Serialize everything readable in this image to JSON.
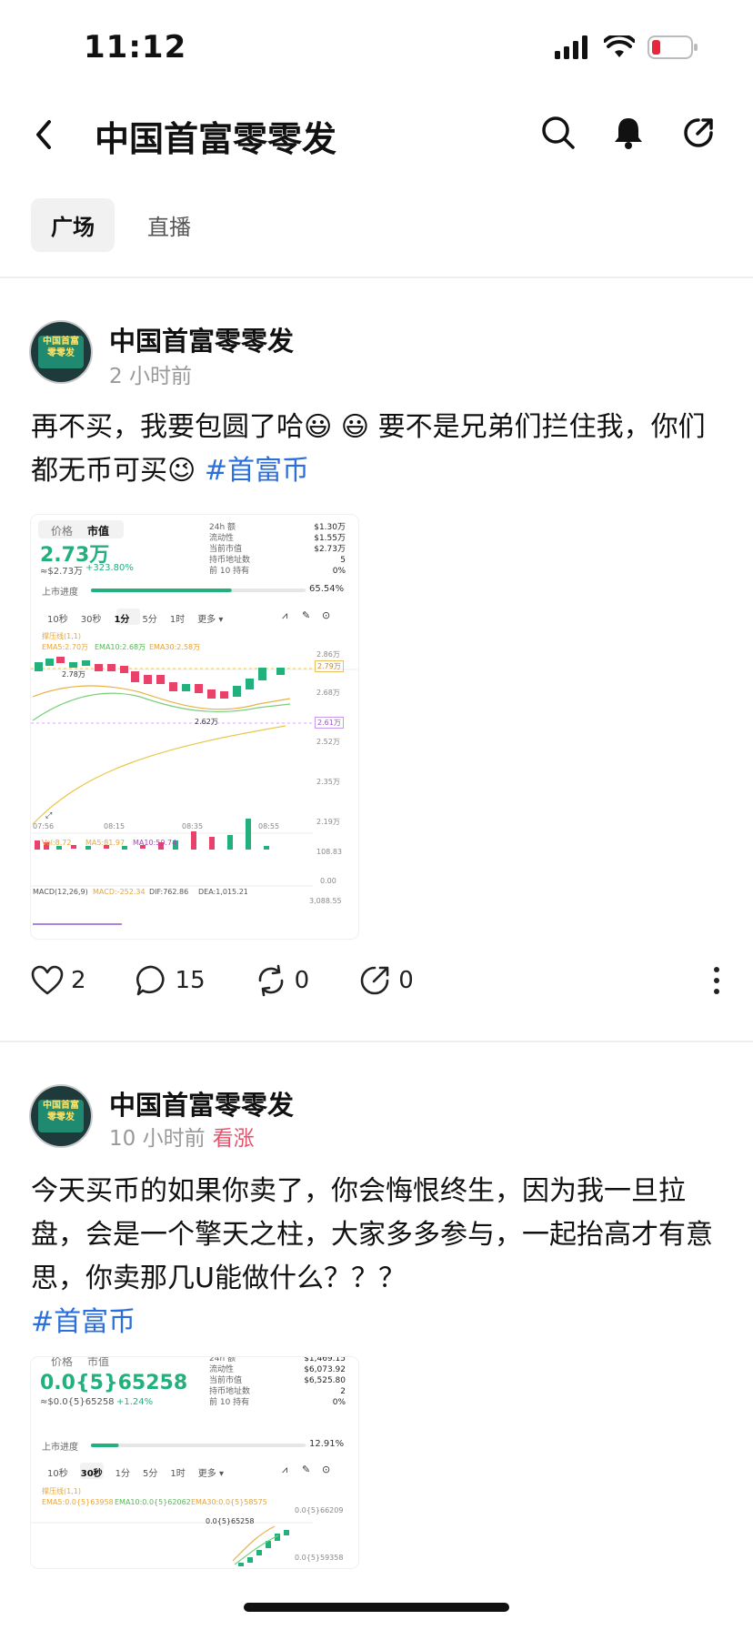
{
  "status": {
    "time": "11:12"
  },
  "header": {
    "title": "中国首富零零发"
  },
  "tabs": [
    {
      "label": "广场"
    },
    {
      "label": "直播"
    }
  ],
  "posts": [
    {
      "author": "中国首富零零发",
      "avatar_text": "中国首富 零零发",
      "time": "2 小时前",
      "tag": "",
      "text": "再不买，我要包圆了哈😃 😃 要不是兄弟们拦住我，你们都无币可买😉 ",
      "hashtag": "#首富币",
      "likes": "2",
      "comments": "15",
      "reposts": "0",
      "shares": "0",
      "chart": {
        "tab_price": "价格",
        "tab_mcap": "市值",
        "value": "2.73万",
        "sub_value": "≈$2.73万",
        "change": "+323.80%",
        "stats": [
          {
            "label": "24h 额",
            "value": "$1.30万"
          },
          {
            "label": "流动性",
            "value": "$1.55万"
          },
          {
            "label": "当前市值",
            "value": "$2.73万"
          },
          {
            "label": "持币地址数",
            "value": "5"
          },
          {
            "label": "前 10 持有",
            "value": "0%"
          }
        ],
        "progress_label": "上市进度",
        "progress_text": "65.54%",
        "progress": 0.6554,
        "intervals": [
          "10秒",
          "30秒",
          "1分",
          "5分",
          "1时",
          "更多 ▾"
        ],
        "active_interval": "1分",
        "indicator": "撑压线(1,1)",
        "ema5": "EMA5:2.70万",
        "ema10": "EMA10:2.68万",
        "ema30": "EMA30:2.58万",
        "y_labels": [
          "2.86万",
          "2.79万",
          "2.68万",
          "2.61万",
          "2.52万",
          "2.35万",
          "2.19万"
        ],
        "high_label": "2.78万",
        "low_label": "2.62万",
        "x_labels": [
          "07:56",
          "08:15",
          "08:35",
          "08:55"
        ],
        "vol": "Vol:8.72",
        "ma5": "MA5:81.97",
        "ma10": "MA10:50.74",
        "vol_max": "108.83",
        "vol_min": "0.00",
        "macd": "MACD(12,26,9)",
        "macd_val": "MACD:-252.34",
        "dif": "DIF:762.86",
        "dea": "DEA:1,015.21",
        "macd_max": "3,088.55"
      }
    },
    {
      "author": "中国首富零零发",
      "avatar_text": "中国首富 零零发",
      "time": "10 小时前",
      "tag": "看涨",
      "text": "今天买币的如果你卖了，你会悔恨终生，因为我一旦拉盘，会是一个擎天之柱，大家多多参与，一起抬高才有意思，你卖那几U能做什么？？？",
      "hashtag": "#首富币",
      "chart": {
        "tab_price": "价格",
        "tab_mcap": "市值",
        "value": "0.0{5}65258",
        "sub_value": "≈$0.0{5}65258",
        "change": "+1.24%",
        "stats": [
          {
            "label": "24h 额",
            "value": "$1,469.15"
          },
          {
            "label": "流动性",
            "value": "$6,073.92"
          },
          {
            "label": "当前市值",
            "value": "$6,525.80"
          },
          {
            "label": "持币地址数",
            "value": "2"
          },
          {
            "label": "前 10 持有",
            "value": "0%"
          }
        ],
        "progress_label": "上市进度",
        "progress_text": "12.91%",
        "progress": 0.1291,
        "intervals": [
          "10秒",
          "30秒",
          "1分",
          "5分",
          "1时",
          "更多 ▾"
        ],
        "active_interval": "30秒",
        "indicator": "撑压线(1,1)",
        "ema5": "EMA5:0.0{5}63958",
        "ema10": "EMA10:0.0{5}62062",
        "ema30": "EMA30:0.0{5}58575",
        "y_labels": [
          "0.0{5}66209",
          "0.0{5}59358"
        ],
        "high_label": "0.0{5}65258"
      }
    }
  ],
  "colors": {
    "up": "#22b07d",
    "down": "#e8416a",
    "hashtag": "#2a6fdb",
    "tag": "#e0546e"
  }
}
